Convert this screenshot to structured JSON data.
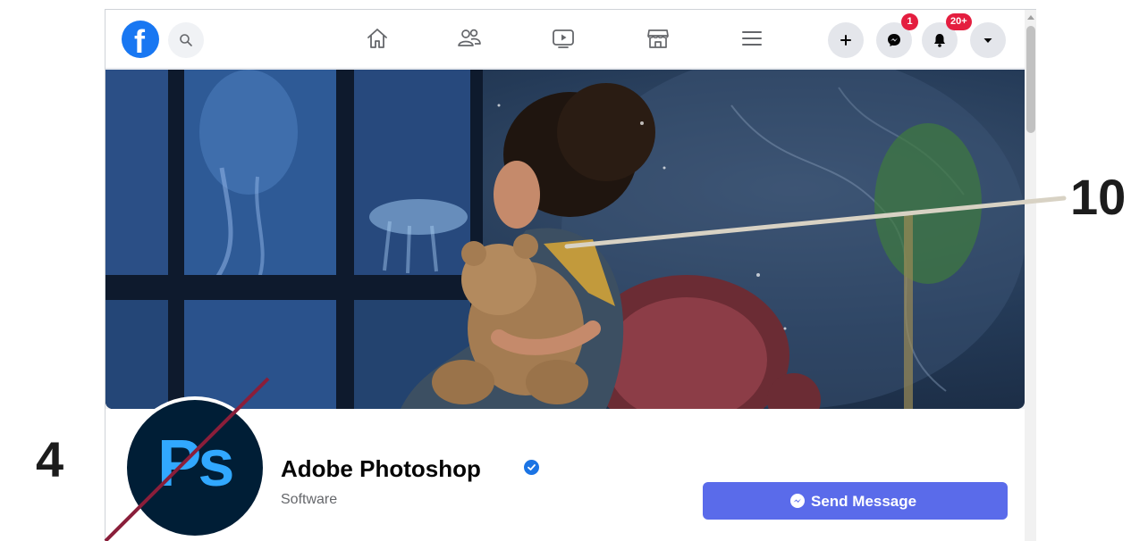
{
  "topnav": {
    "logo_letter": "f",
    "messenger_badge": "1",
    "notifications_badge": "20+"
  },
  "profile": {
    "name": "Adobe Photoshop",
    "category": "Software",
    "avatar_text": "Ps",
    "send_message_label": "Send Message"
  },
  "callouts": {
    "left_number": "4",
    "right_number": "10"
  },
  "colors": {
    "fb_blue": "#1877f2",
    "send_button": "#5a6bea",
    "badge_red": "#e41e3f",
    "photoshop_navy": "#001e36",
    "photoshop_blue": "#31a8ff",
    "callout_red_line": "#8a1e3a",
    "callout_beige_line": "#d8d2c4"
  },
  "icons": {
    "search": "search-icon",
    "home": "home-icon",
    "friends": "friends-icon",
    "watch": "video-icon",
    "marketplace": "store-icon",
    "menu": "hamburger-icon",
    "create": "plus-icon",
    "messenger": "messenger-icon",
    "notifications": "bell-icon",
    "account": "caret-down-icon",
    "verified": "verified-badge-icon"
  }
}
